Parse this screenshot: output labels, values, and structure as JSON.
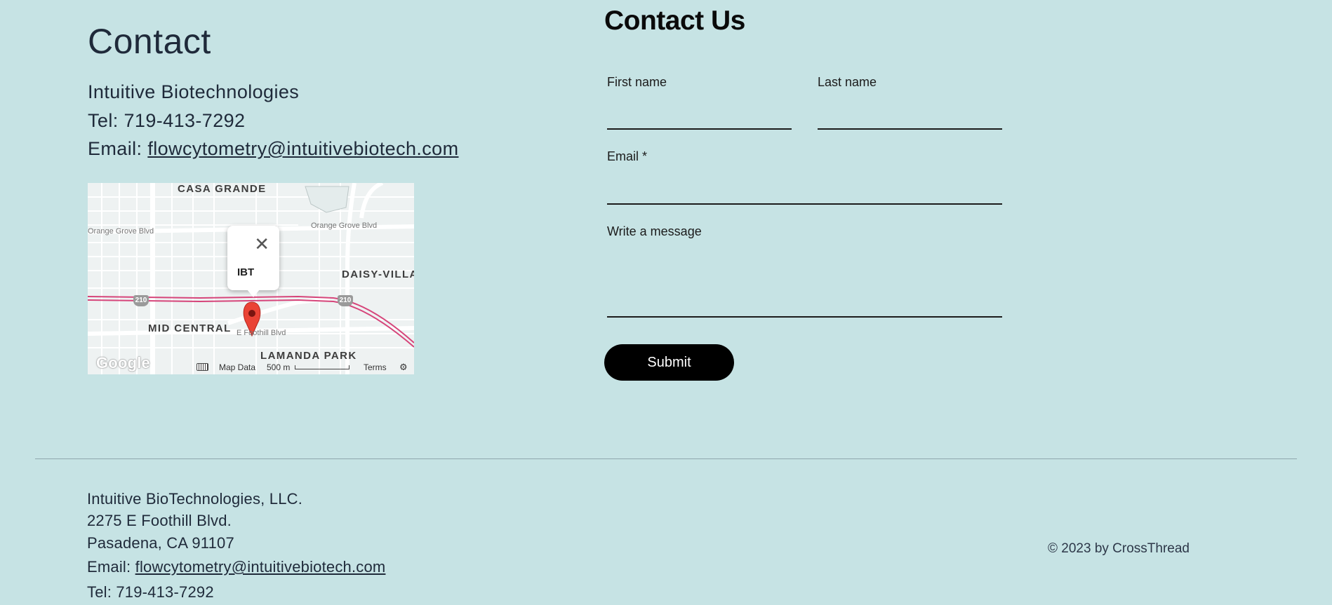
{
  "contact": {
    "title": "Contact",
    "company": "Intuitive Biotechnologies",
    "tel": "Tel: 719-413-7292",
    "email_prefix": "Email: ",
    "email": "flowcytometry@intuitivebiotech.com"
  },
  "map": {
    "areas": [
      "CASA GRANDE",
      "DAISY-VILLA",
      "MID CENTRAL",
      "LAMANDA PARK"
    ],
    "streets": [
      "Orange Grove Blvd",
      "Orange Grove Blvd",
      "E Foothill Blvd"
    ],
    "highway": "210",
    "pin_label": "IBT",
    "close_glyph": "✕",
    "logo": "Google",
    "map_data": "Map Data",
    "scale": "500 m",
    "terms": "Terms",
    "pin_color": "#ea4335",
    "highway_color": "#d6457a"
  },
  "form": {
    "title": "Contact Us",
    "first_name_label": "First name",
    "last_name_label": "Last name",
    "email_label": "Email *",
    "message_label": "Write a message",
    "submit_label": "Submit",
    "first_name_value": "",
    "last_name_value": "",
    "email_value": "",
    "message_value": ""
  },
  "footer": {
    "company": "Intuitive BioTechnologies, LLC.",
    "address1": "2275 E Foothill Blvd.",
    "address2": "Pasadena, CA 91107",
    "email_prefix": "Email: ",
    "email": "flowcytometry@intuitivebiotech.com",
    "tel": "Tel: 719-413-7292",
    "copyright": "© 2023 by CrossThread"
  },
  "colors": {
    "background": "#c6e3e4",
    "text": "#1f2a3a",
    "button": "#000000"
  }
}
